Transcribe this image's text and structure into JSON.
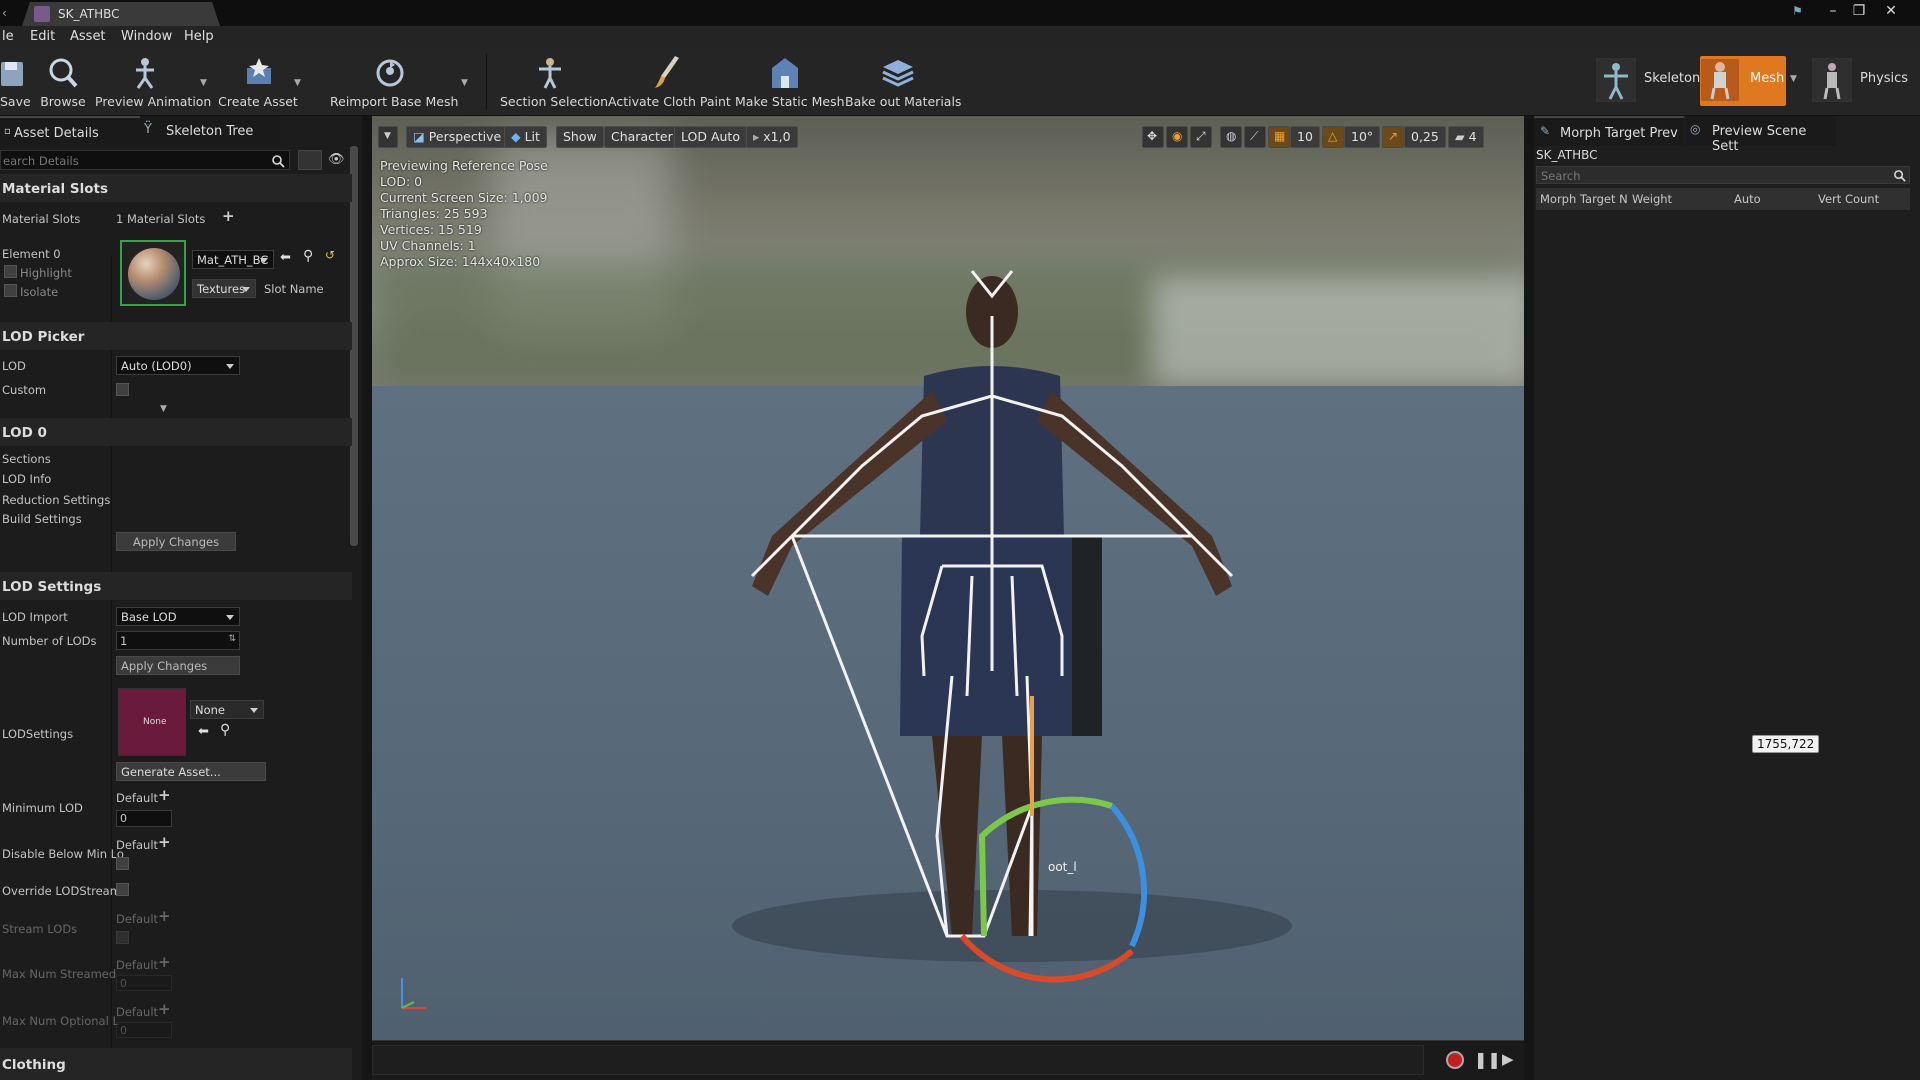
{
  "window": {
    "tab_title": "SK_ATHBC"
  },
  "menu": [
    "le",
    "Edit",
    "Asset",
    "Window",
    "Help"
  ],
  "toolbar": {
    "items": [
      "Save",
      "Browse",
      "Preview Animation",
      "Create Asset",
      "Reimport Base Mesh",
      "Section Selection",
      "Activate Cloth Paint",
      "Make Static Mesh",
      "Bake out Materials"
    ],
    "modes": [
      "Skeleton",
      "Mesh",
      "Physics"
    ],
    "accent": "#e07820"
  },
  "left_tabs": [
    "Asset Details",
    "Skeleton Tree"
  ],
  "details": {
    "search_placeholder": "earch Details",
    "material_slots": {
      "header": "Material Slots",
      "label": "Material Slots",
      "count": "1 Material Slots",
      "element": "Element 0",
      "highlight": "Highlight",
      "isolate": "Isolate",
      "material": "Mat_ATH_BC",
      "textures": "Textures",
      "slot_name": "Slot Name"
    },
    "lod_picker": {
      "header": "LOD Picker",
      "lod_label": "LOD",
      "lod_value": "Auto (LOD0)",
      "custom_label": "Custom"
    },
    "lod0": {
      "header": "LOD 0",
      "items": [
        "Sections",
        "LOD Info",
        "Reduction Settings",
        "Build Settings"
      ],
      "apply": "Apply Changes"
    },
    "lod_settings": {
      "header": "LOD Settings",
      "lod_import_label": "LOD Import",
      "lod_import_value": "Base LOD",
      "num_lods_label": "Number of LODs",
      "num_lods_value": "1",
      "apply": "Apply Changes",
      "lodsettings_label": "LODSettings",
      "thumb_text": "None",
      "asset_value": "None",
      "generate": "Generate Asset...",
      "min_lod_label": "Minimum LOD",
      "default_text": "Default",
      "min_lod_value": "0",
      "disable_below_label": "Disable Below Min Lo",
      "override_label": "Override LODStreami",
      "stream_lods_label": "Stream LODs",
      "max_streamed_label": "Max Num Streamed",
      "max_streamed_value": "0",
      "max_optional_label": "Max Num Optional L",
      "max_optional_value": "0"
    },
    "clothing_header": "Clothing"
  },
  "viewport": {
    "buttons": [
      "Perspective",
      "Lit",
      "Show",
      "Character",
      "LOD Auto",
      "x1,0"
    ],
    "right_values": [
      "10",
      "10°",
      "0,25",
      "4"
    ],
    "stats": [
      "Previewing Reference Pose",
      "LOD: 0",
      "Current Screen Size: 1,009",
      "Triangles: 25 593",
      "Vertices: 15 519",
      "UV Channels: 1",
      "Approx Size: 144x40x180"
    ],
    "bone_label": "oot_l"
  },
  "right_panel": {
    "tabs": [
      "Morph Target Prev",
      "Preview Scene Sett"
    ],
    "asset": "SK_ATHBC",
    "search_placeholder": "Search",
    "columns": [
      "Morph Target N",
      "Weight",
      "Auto",
      "Vert Count"
    ]
  },
  "mouse_coord": "1755,722"
}
